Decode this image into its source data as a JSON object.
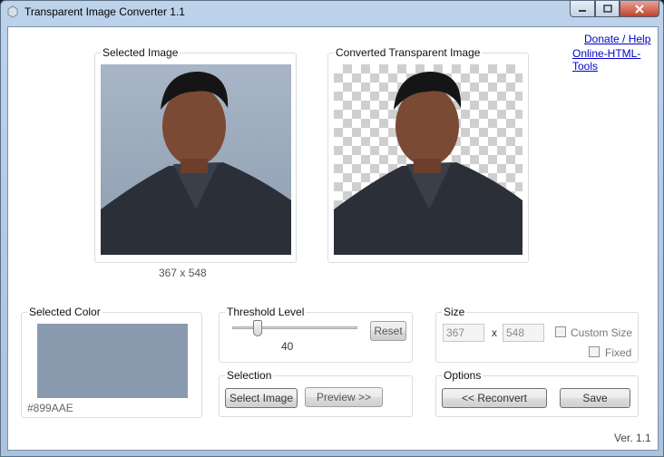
{
  "window": {
    "title": "Transparent Image Converter 1.1"
  },
  "links": {
    "donate": "Donate / Help",
    "tools": "Online-HTML-Tools"
  },
  "selected_image": {
    "legend": "Selected Image",
    "dimensions": "367 x 548"
  },
  "converted_image": {
    "legend": "Converted Transparent Image"
  },
  "selected_color": {
    "legend": "Selected Color",
    "hex": "#899AAE",
    "swatch": "#899AAE"
  },
  "threshold": {
    "legend": "Threshold Level",
    "value": "40",
    "reset_label": "Reset",
    "level_fraction": 0.2
  },
  "selection": {
    "legend": "Selection",
    "select_label": "Select Image",
    "preview_label": "Preview >>"
  },
  "size": {
    "legend": "Size",
    "width": "367",
    "x_label": "x",
    "height": "548",
    "custom_size_label": "Custom Size",
    "fixed_label": "Fixed"
  },
  "options": {
    "legend": "Options",
    "reconvert_label": "<< Reconvert",
    "save_label": "Save"
  },
  "version": "Ver. 1.1"
}
